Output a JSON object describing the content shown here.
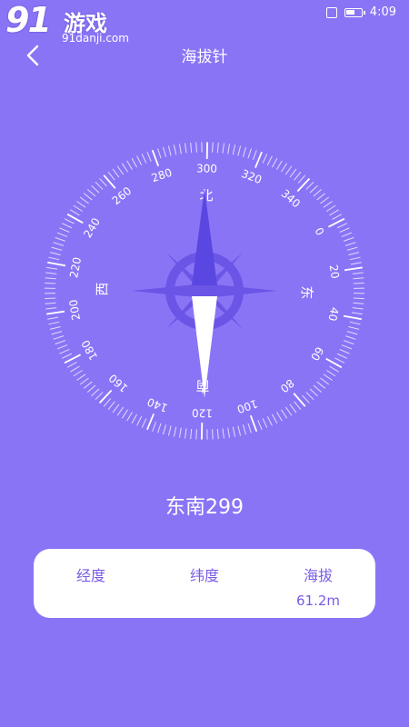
{
  "status_bar": {
    "time": "4:09",
    "vibrate_icon": "vibrate-icon",
    "battery_icon": "battery-icon"
  },
  "watermark": {
    "logo": "91游戏",
    "url": "91danji.com"
  },
  "header": {
    "title": "海拔针",
    "back_icon": "chevron-left-icon"
  },
  "compass": {
    "labels": [
      "0",
      "20",
      "40",
      "60",
      "80",
      "100",
      "120",
      "140",
      "160",
      "180",
      "200",
      "220",
      "240",
      "260",
      "280",
      "300",
      "320",
      "340"
    ],
    "directions": {
      "east": "东",
      "south": "南",
      "west": "西",
      "north": "北"
    }
  },
  "reading": "东南299",
  "info": {
    "longitude": {
      "label": "经度",
      "value": ""
    },
    "latitude": {
      "label": "纬度",
      "value": ""
    },
    "altitude": {
      "label": "海拔",
      "value": "61.2m"
    }
  },
  "colors": {
    "background": "#8a74f6",
    "accent": "#7a5be6",
    "rose": "#6a55e6"
  }
}
